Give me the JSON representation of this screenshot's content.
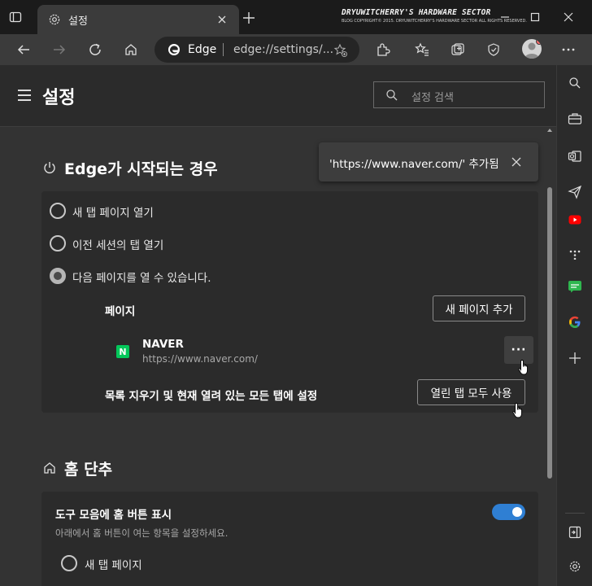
{
  "browser": {
    "tab": {
      "title": "설정"
    },
    "watermark": {
      "line1": "DRYUWITCHERRY'S HARDWARE SECTOR",
      "line2": "BLOG COPYRIGHT© 2015. DRYUWITCHERRY'S HARDWARE SECTOR ALL RIGHTS RESERVED."
    },
    "address": {
      "site": "Edge",
      "url": "edge://settings/..."
    }
  },
  "settings": {
    "title": "설정",
    "search_placeholder": "설정 검색",
    "startup": {
      "title": "Edge가 시작되는 경우",
      "options": [
        {
          "label": "새 탭 페이지 열기",
          "checked": false
        },
        {
          "label": "이전 세션의 탭 열기",
          "checked": false
        },
        {
          "label": "다음 페이지를 열 수 있습니다.",
          "checked": true
        }
      ],
      "pages_label": "페이지",
      "add_page_button": "새 페이지 추가",
      "page_entry": {
        "name": "NAVER",
        "url": "https://www.naver.com/",
        "favicon_letter": "N"
      },
      "more_label": "···",
      "clear_label": "목록 지우기 및 현재 열려 있는 모든 탭에 설정",
      "use_open_tabs_button": "열린 탭 모두 사용"
    },
    "home": {
      "title": "홈 단추",
      "toggle_label": "도구 모음에 홈 버튼 표시",
      "toggle_on": true,
      "description": "아래에서 홈 버튼이 여는 항목을 설정하세요.",
      "option": "새 탭 페이지"
    },
    "toast": {
      "text": "'https://www.naver.com/' 추가됨"
    }
  },
  "colors": {
    "accent": "#2f7fd3",
    "naver_green": "#03c75a"
  }
}
